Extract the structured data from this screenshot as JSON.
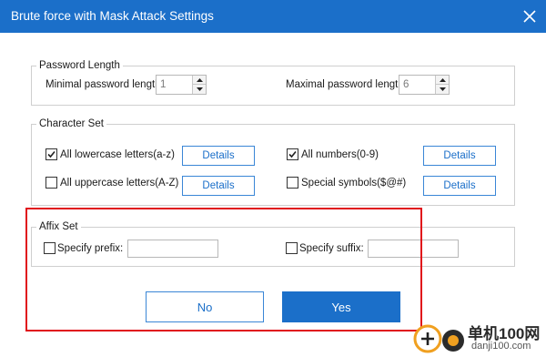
{
  "window": {
    "title": "Brute force with Mask Attack Settings",
    "close_icon": "close-icon"
  },
  "password_length": {
    "legend": "Password Length",
    "min_label": "Minimal password length",
    "min_value": "1",
    "max_label": "Maximal password length",
    "max_value": "6"
  },
  "character_set": {
    "legend": "Character Set",
    "lowercase": {
      "label": "All lowercase letters(a-z)",
      "checked": true
    },
    "uppercase": {
      "label": "All uppercase letters(A-Z)",
      "checked": false
    },
    "numbers": {
      "label": "All numbers(0-9)",
      "checked": true
    },
    "special": {
      "label": "Special symbols($@#)",
      "checked": false
    },
    "details_label": "Details"
  },
  "affix_set": {
    "legend": "Affix Set",
    "prefix_label": "Specify prefix:",
    "prefix_value": "",
    "suffix_label": "Specify suffix:",
    "suffix_value": ""
  },
  "buttons": {
    "no": "No",
    "yes": "Yes"
  },
  "watermark": {
    "name": "单机100网",
    "url": "danji100.com"
  },
  "colors": {
    "accent": "#1b6fc9",
    "highlight": "#e0101a"
  }
}
